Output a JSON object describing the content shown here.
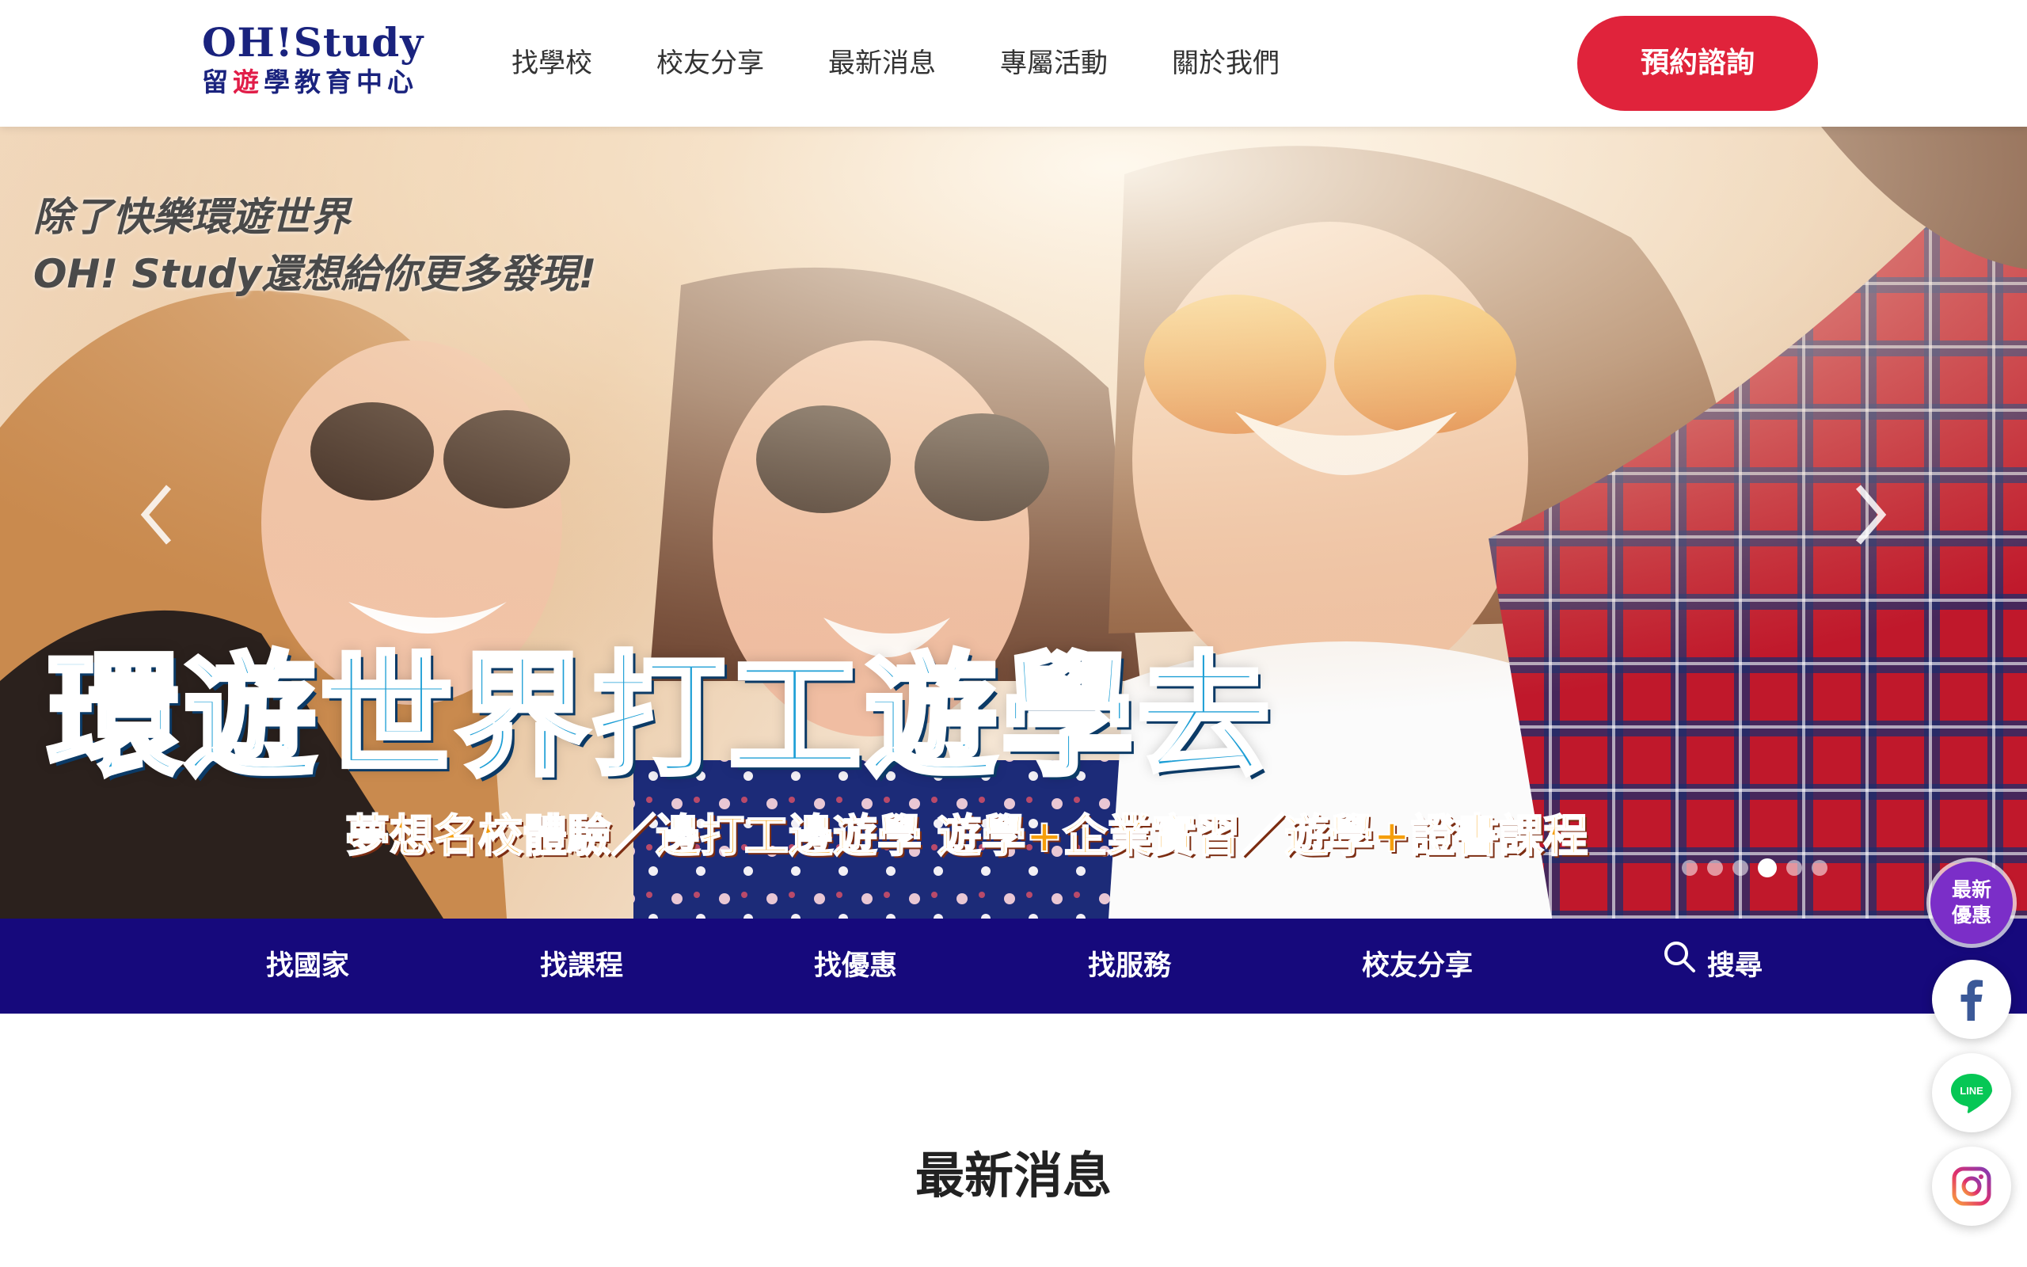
{
  "header": {
    "logo_main": "OH!Study",
    "logo_sub_1": "留",
    "logo_sub_2": "遊",
    "logo_sub_3": "學教育中心",
    "nav": [
      {
        "label": "找學校"
      },
      {
        "label": "校友分享"
      },
      {
        "label": "最新消息"
      },
      {
        "label": "專屬活動"
      },
      {
        "label": "關於我們"
      }
    ],
    "cta_label": "預約諮詢"
  },
  "hero": {
    "tagline_line1": "除了快樂環遊世界",
    "tagline_line2": "OH! Study還想給你更多發現!",
    "title": "環遊世界打工遊學去",
    "subtitle": "夢想名校體驗／邊打工邊遊學  遊學+企業實習／遊學+證書課程",
    "slide_count": 6,
    "active_slide": 4
  },
  "subnav": {
    "items": [
      {
        "label": "找國家"
      },
      {
        "label": "找課程"
      },
      {
        "label": "找優惠"
      },
      {
        "label": "找服務"
      },
      {
        "label": "校友分享"
      }
    ],
    "search_label": "搜尋"
  },
  "section": {
    "title": "最新消息"
  },
  "floating": {
    "promo_line1": "最新",
    "promo_line2": "優惠",
    "social": [
      "facebook-icon",
      "line-icon",
      "instagram-icon"
    ],
    "line_text": "LINE"
  },
  "colors": {
    "brand_navy": "#1a237e",
    "cta_red": "#e0233b",
    "subnav_bg": "#16097c",
    "promo_purple": "#7b2ec8",
    "facebook": "#3b5998",
    "line": "#06c755"
  }
}
